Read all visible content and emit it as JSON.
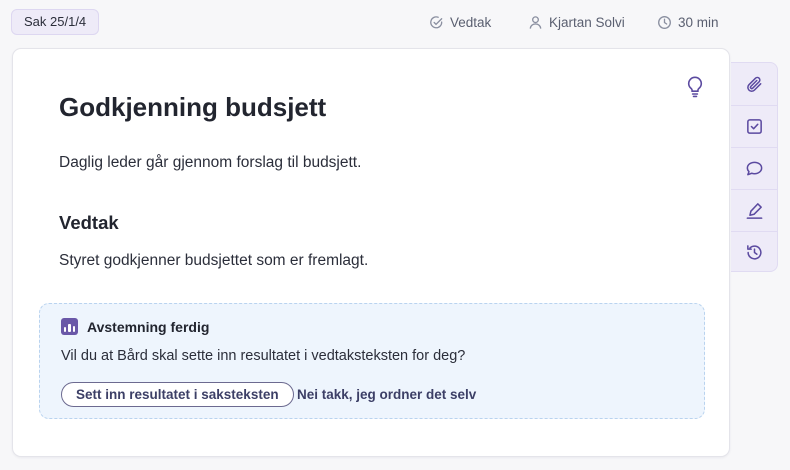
{
  "header": {
    "case_number": "Sak 25/1/4",
    "type_label": "Vedtak",
    "person": "Kjartan Solvi",
    "duration": "30 min"
  },
  "item": {
    "title": "Godkjenning budsjett",
    "intro": "Daglig leder går gjennom forslag til budsjett.",
    "section_heading": "Vedtak",
    "decision_text": "Styret godkjenner budsjettet som er fremlagt."
  },
  "vote_panel": {
    "title": "Avstemning ferdig",
    "question": "Vil du at Bård skal sette inn resultatet i vedtaksteksten for deg?",
    "insert_label": "Sett inn resultatet i saksteksten",
    "decline_label": "Nei takk, jeg ordner det selv"
  },
  "icons": {
    "header": [
      "check-circle-icon",
      "user-icon",
      "clock-icon"
    ],
    "card": [
      "lightbulb-icon",
      "bar-chart-icon"
    ],
    "side_tools": [
      "paperclip-icon",
      "checkbox-icon",
      "comment-icon",
      "pen-icon",
      "history-icon"
    ]
  },
  "colors": {
    "accent": "#6a58a8",
    "side_panel": "#eeebf8",
    "vote_panel_bg": "#eef5fd",
    "icon_purple": "#5b4aa0"
  }
}
